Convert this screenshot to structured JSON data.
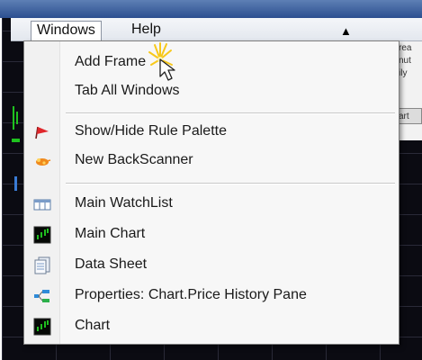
{
  "menubar": {
    "windows_label": "Windows",
    "help_label": "Help",
    "collapse_arrow": "▲"
  },
  "background": {
    "panel_fragments": [
      "rea",
      "nut",
      "ily",
      "art"
    ]
  },
  "menu": {
    "items": [
      {
        "label": "Add Frame",
        "icon": "none"
      },
      {
        "label": "Tab All Windows",
        "icon": "none"
      },
      {
        "label": "Show/Hide Rule Palette",
        "icon": "red-flag-icon"
      },
      {
        "label": "New BackScanner",
        "icon": "orange-scanner-icon"
      },
      {
        "label": "Main WatchList",
        "icon": "watchlist-icon"
      },
      {
        "label": "Main Chart",
        "icon": "chart-icon"
      },
      {
        "label": "Data Sheet",
        "icon": "data-sheet-icon"
      },
      {
        "label": "Properties: Chart.Price History Pane",
        "icon": "properties-icon"
      },
      {
        "label": "Chart",
        "icon": "chart-icon"
      }
    ]
  },
  "colors": {
    "menu_background": "#f7f7f7",
    "app_background": "#0b0b12",
    "chart_green": "#1fc21f",
    "flag_red": "#e0262b",
    "cursor_highlight": "#f7c81a"
  }
}
